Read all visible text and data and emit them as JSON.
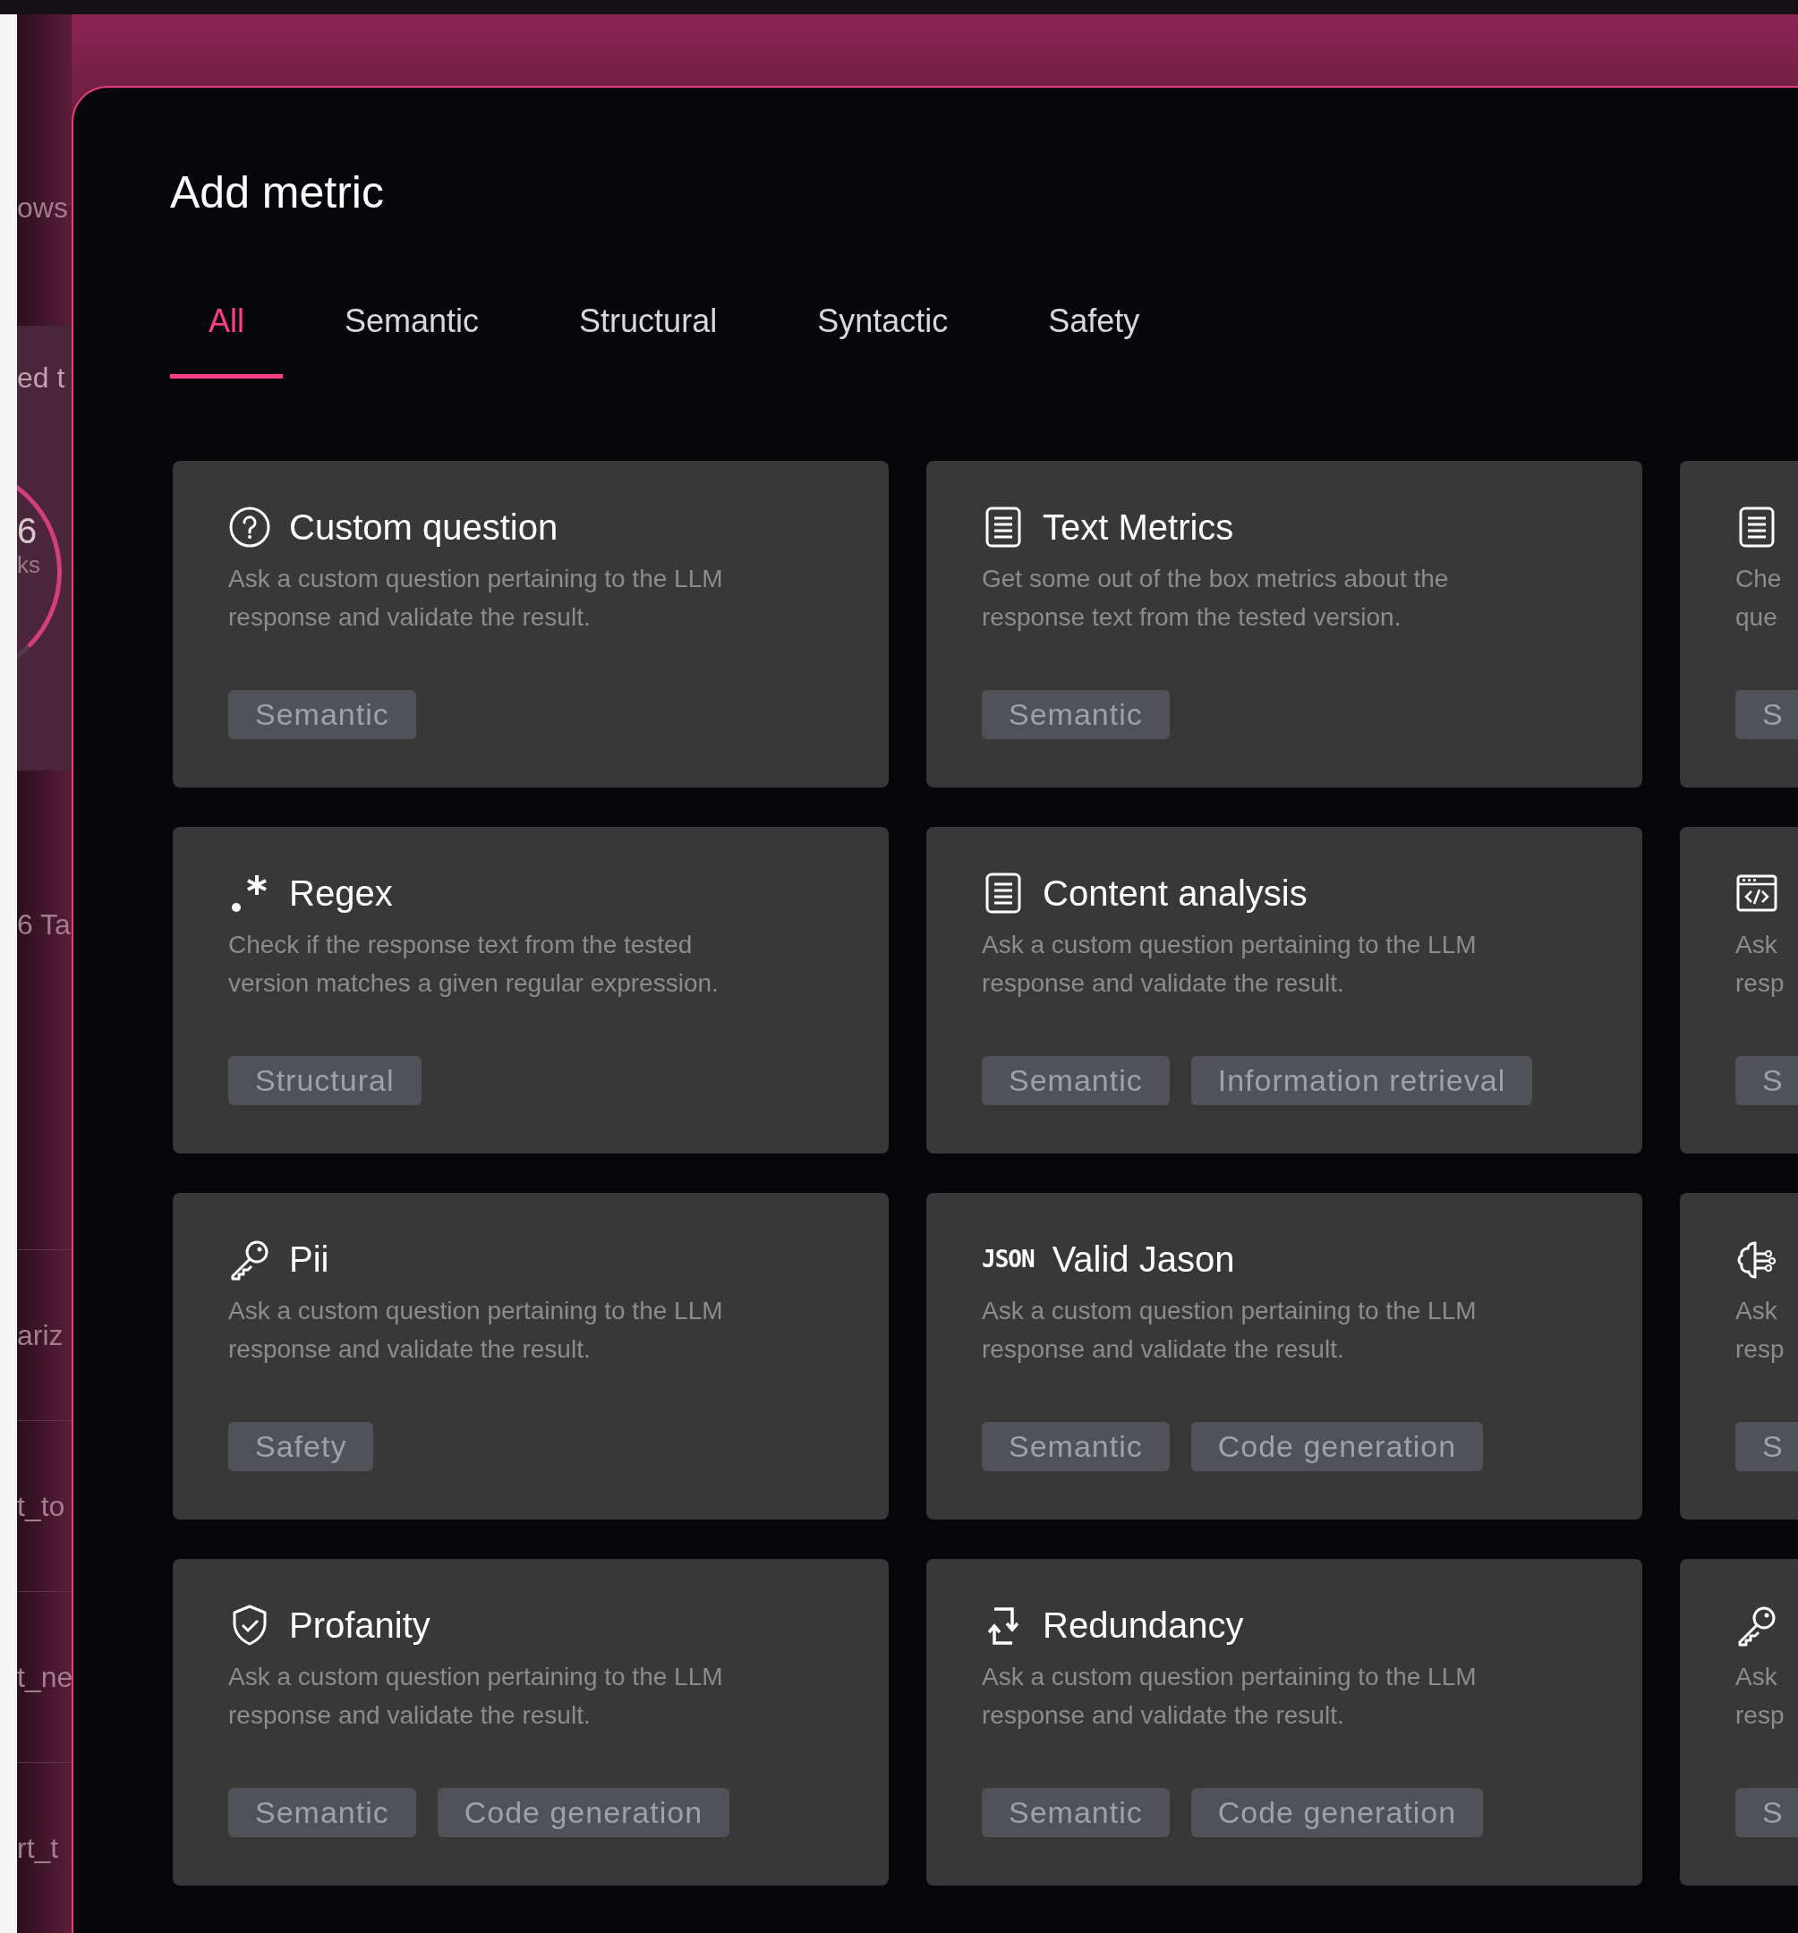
{
  "background_page": {
    "items": [
      {
        "kind": "label",
        "text": "ows"
      },
      {
        "kind": "panel",
        "title": "ed t",
        "value": "6",
        "caption": "ks"
      },
      {
        "kind": "label",
        "text": "6 Ta"
      },
      {
        "kind": "row",
        "text": "ariz"
      },
      {
        "kind": "row",
        "text": "t_to"
      },
      {
        "kind": "row",
        "text": "t_ne"
      },
      {
        "kind": "row",
        "text": "rt_t"
      }
    ]
  },
  "dialog": {
    "title": "Add metric",
    "tabs": [
      {
        "label": "All",
        "selected": true
      },
      {
        "label": "Semantic",
        "selected": false
      },
      {
        "label": "Structural",
        "selected": false
      },
      {
        "label": "Syntactic",
        "selected": false
      },
      {
        "label": "Safety",
        "selected": false
      }
    ],
    "cards": [
      {
        "title": "Custom question",
        "description_lines": [
          "Ask a custom question pertaining to the LLM",
          "response and validate the result."
        ],
        "tags": [
          "Semantic"
        ]
      },
      {
        "title": "Text Metrics",
        "description_lines": [
          "Get some out of the box metrics about the",
          "response text from the tested version."
        ],
        "tags": [
          "Semantic"
        ]
      },
      {
        "description_lines": [
          "Che",
          "que"
        ],
        "tags": [
          "S"
        ]
      },
      {
        "title": "Regex",
        "description_lines": [
          "Check if the response text from the tested",
          "version matches a given regular expression."
        ],
        "tags": [
          "Structural"
        ]
      },
      {
        "title": "Content analysis",
        "description_lines": [
          "Ask a custom question pertaining to the LLM",
          "response and validate the result."
        ],
        "tags": [
          "Semantic",
          "Information retrieval"
        ]
      },
      {
        "description_lines": [
          "Ask",
          "resp"
        ],
        "tags": [
          "S"
        ]
      },
      {
        "title": "Pii",
        "description_lines": [
          "Ask a custom question pertaining to the LLM",
          "response and validate the result."
        ],
        "tags": [
          "Safety"
        ]
      },
      {
        "icon_text": "JSON",
        "title": "Valid Jason",
        "description_lines": [
          "Ask a custom question pertaining to the LLM",
          "response and validate the result."
        ],
        "tags": [
          "Semantic",
          "Code generation"
        ]
      },
      {
        "description_lines": [
          "Ask",
          "resp"
        ],
        "tags": [
          "S"
        ]
      },
      {
        "title": "Profanity",
        "description_lines": [
          "Ask a custom question pertaining to the LLM",
          "response and validate the result."
        ],
        "tags": [
          "Semantic",
          "Code generation"
        ]
      },
      {
        "title": "Redundancy",
        "description_lines": [
          "Ask a custom question pertaining to the LLM",
          "response and validate the result."
        ],
        "tags": [
          "Semantic",
          "Code generation"
        ]
      },
      {
        "description_lines": [
          "Ask",
          "resp"
        ],
        "tags": [
          "S"
        ]
      }
    ]
  }
}
